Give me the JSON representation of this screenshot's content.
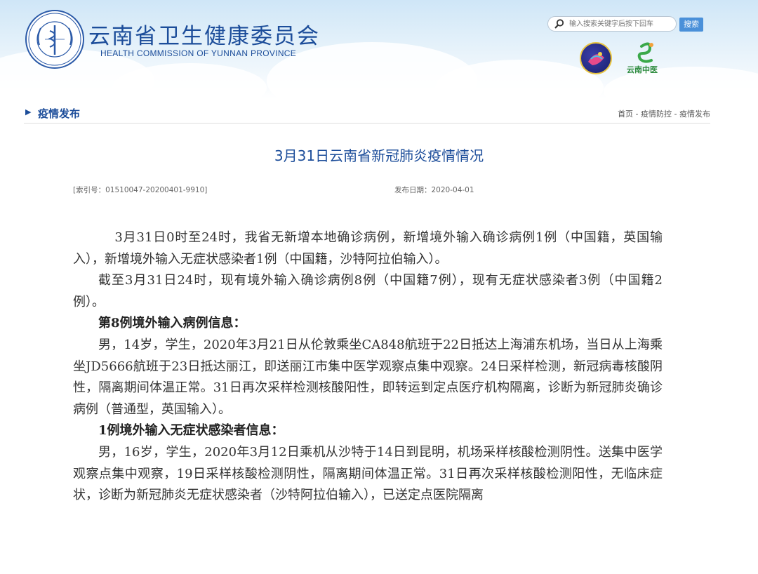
{
  "header": {
    "site_title": "云南省卫生健康委员会",
    "site_title_en": "HEALTH COMMISSION OF YUNNAN PROVINCE",
    "search": {
      "placeholder": "输入搜索关键字后按下回车",
      "button_label": "搜索"
    },
    "tcm_logo_label": "云南中医"
  },
  "section": {
    "title": "疫情发布",
    "breadcrumb": [
      "首页",
      "疫情防控",
      "疫情发布"
    ],
    "breadcrumb_separator": " - "
  },
  "article": {
    "title": "3月31日云南省新冠肺炎疫情情况",
    "index_number": "[索引号：01510047-20200401-9910]",
    "publish_date": "发布日期：2020-04-01",
    "paragraphs": [
      "3月31日0时至24时，我省无新增本地确诊病例，新增境外输入确诊病例1例（中国籍，英国输入），新增境外输入无症状感染者1例（中国籍，沙特阿拉伯输入）。",
      "截至3月31日24时，现有境外输入确诊病例8例（中国籍7例），现有无症状感染者3例（中国籍2例）。",
      "第8例境外输入病例信息：",
      "男，14岁，学生，2020年3月21日从伦敦乘坐CA848航班于22日抵达上海浦东机场，当日从上海乘坐JD5666航班于23日抵达丽江，即送丽江市集中医学观察点集中观察。24日采样检测，新冠病毒核酸阴性，隔离期间体温正常。31日再次采样检测核酸阳性，即转运到定点医疗机构隔离，诊断为新冠肺炎确诊病例（普通型，英国输入）。",
      "1例境外输入无症状感染者信息：",
      "男，16岁，学生，2020年3月12日乘机从沙特于14日到昆明，机场采样核酸检测阴性。送集中医学观察点集中观察，19日采样核酸检测阴性，隔离期间体温正常。31日再次采样核酸检测阳性，无临床症状，诊断为新冠肺炎无症状感染者（沙特阿拉伯输入），已送定点医院隔离"
    ]
  },
  "colors": {
    "brand_blue": "#1c4d9a",
    "search_button": "#4a90d9",
    "tcm_green": "#2e8b3e"
  }
}
